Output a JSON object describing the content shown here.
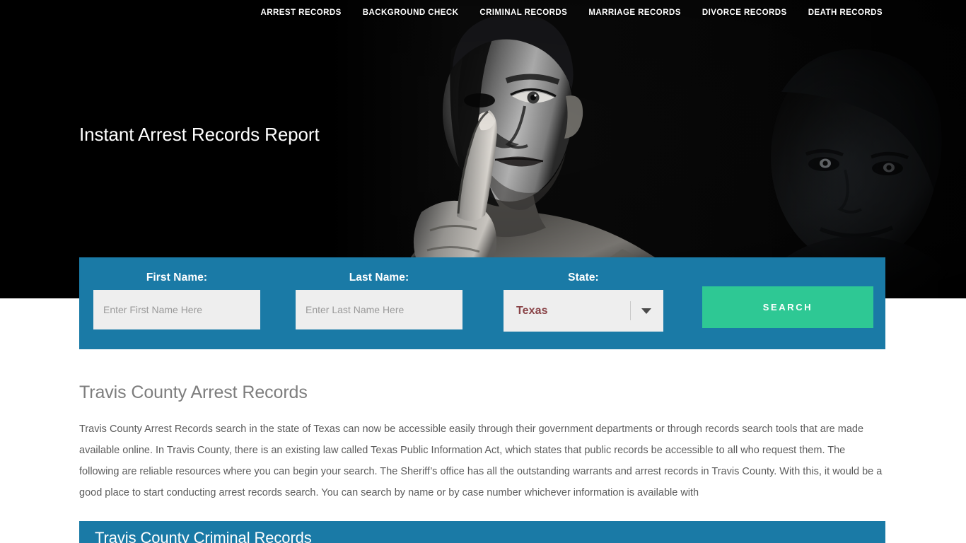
{
  "nav": {
    "items": [
      {
        "label": "ARREST RECORDS",
        "name": "nav-arrest-records"
      },
      {
        "label": "BACKGROUND CHECK",
        "name": "nav-background-check"
      },
      {
        "label": "CRIMINAL RECORDS",
        "name": "nav-criminal-records"
      },
      {
        "label": "MARRIAGE RECORDS",
        "name": "nav-marriage-records"
      },
      {
        "label": "DIVORCE RECORDS",
        "name": "nav-divorce-records"
      },
      {
        "label": "DEATH RECORDS",
        "name": "nav-death-records"
      }
    ]
  },
  "hero": {
    "title": "Instant Arrest Records Report",
    "image_alt": "man-shushing-finger-to-lips-grayscale"
  },
  "search_form": {
    "first_name": {
      "label": "First Name:",
      "placeholder": "Enter First Name Here",
      "value": ""
    },
    "last_name": {
      "label": "Last Name:",
      "placeholder": "Enter Last Name Here",
      "value": ""
    },
    "state": {
      "label": "State:",
      "selected": "Texas"
    },
    "submit_label": "SEARCH"
  },
  "main": {
    "heading": "Travis County Arrest Records",
    "paragraph": "Travis County Arrest Records search in the state of Texas can now be accessible easily through their government departments or through records search tools that are made available online. In Travis County, there is an existing law called Texas Public Information Act, which states that public records be accessible to all who request them. The following are reliable resources where you can begin your search. The Sheriff’s office has all the outstanding warrants and arrest records in Travis County. With this, it would be a good place to start conducting arrest records search. You can search by name or by case number whichever information is available with"
  },
  "bottom_panel": {
    "title": "Travis County Criminal Records"
  },
  "colors": {
    "brand_blue": "#1a7aa6",
    "accent_green": "#2ec894",
    "hero_black": "#000000",
    "state_text": "#8a4448",
    "body_text": "#5b5b5b",
    "heading_gray": "#7d7d7d"
  }
}
